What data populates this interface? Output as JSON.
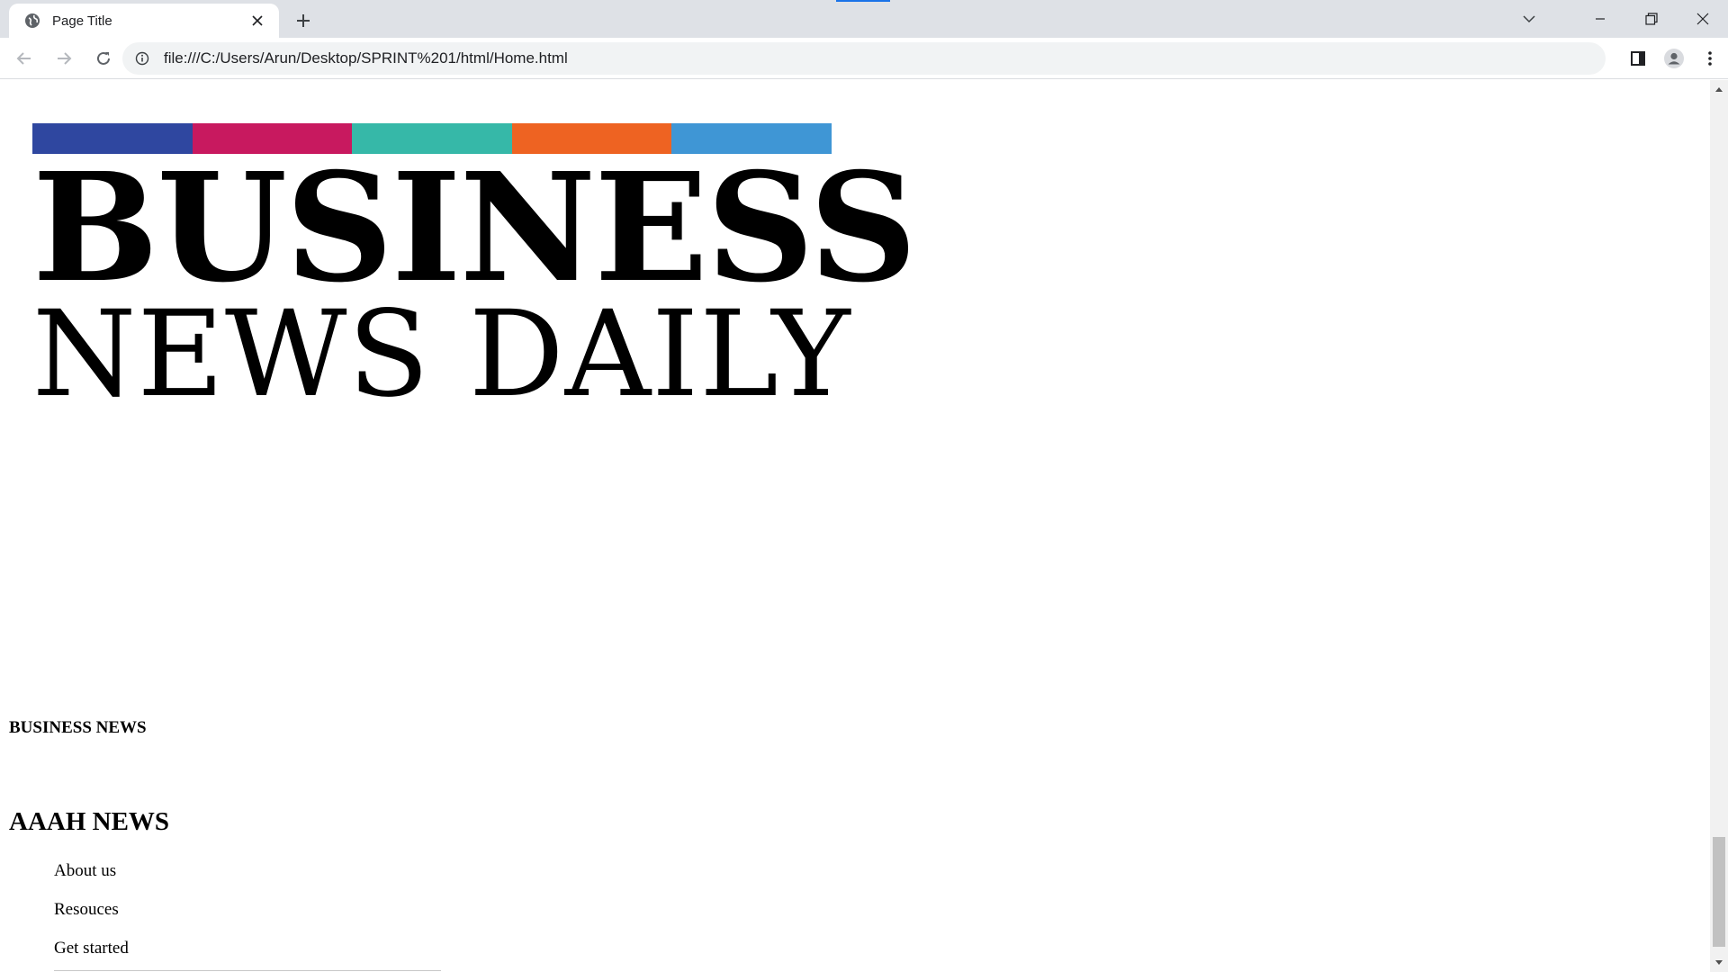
{
  "browser": {
    "tab": {
      "title": "Page Title",
      "favicon_icon": "globe-icon",
      "close_icon": "close-icon"
    },
    "new_tab_icon": "plus-icon",
    "tab_search_icon": "chevron-down-icon",
    "window_controls": [
      "minimize-icon",
      "restore-icon",
      "close-icon"
    ],
    "nav": [
      "back-arrow-icon",
      "forward-arrow-icon",
      "reload-icon"
    ],
    "address_bar": {
      "info_icon": "info-icon",
      "url": "file:///C:/Users/Arun/Desktop/SPRINT%201/html/Home.html"
    },
    "toolbar_right": [
      "side-panel-icon",
      "profile-icon",
      "more-menu-icon"
    ]
  },
  "page": {
    "logo": {
      "line1": "BUSINESS",
      "line2": "NEWS DAILY",
      "bar_colors": [
        "#2f47a0",
        "#c8195f",
        "#36b8a8",
        "#ee6322",
        "#3f96d5"
      ]
    },
    "section_heading": "BUSINESS NEWS",
    "footer_heading": "AAAH NEWS",
    "footer_links": [
      "About us",
      "Resouces",
      "Get started"
    ]
  }
}
